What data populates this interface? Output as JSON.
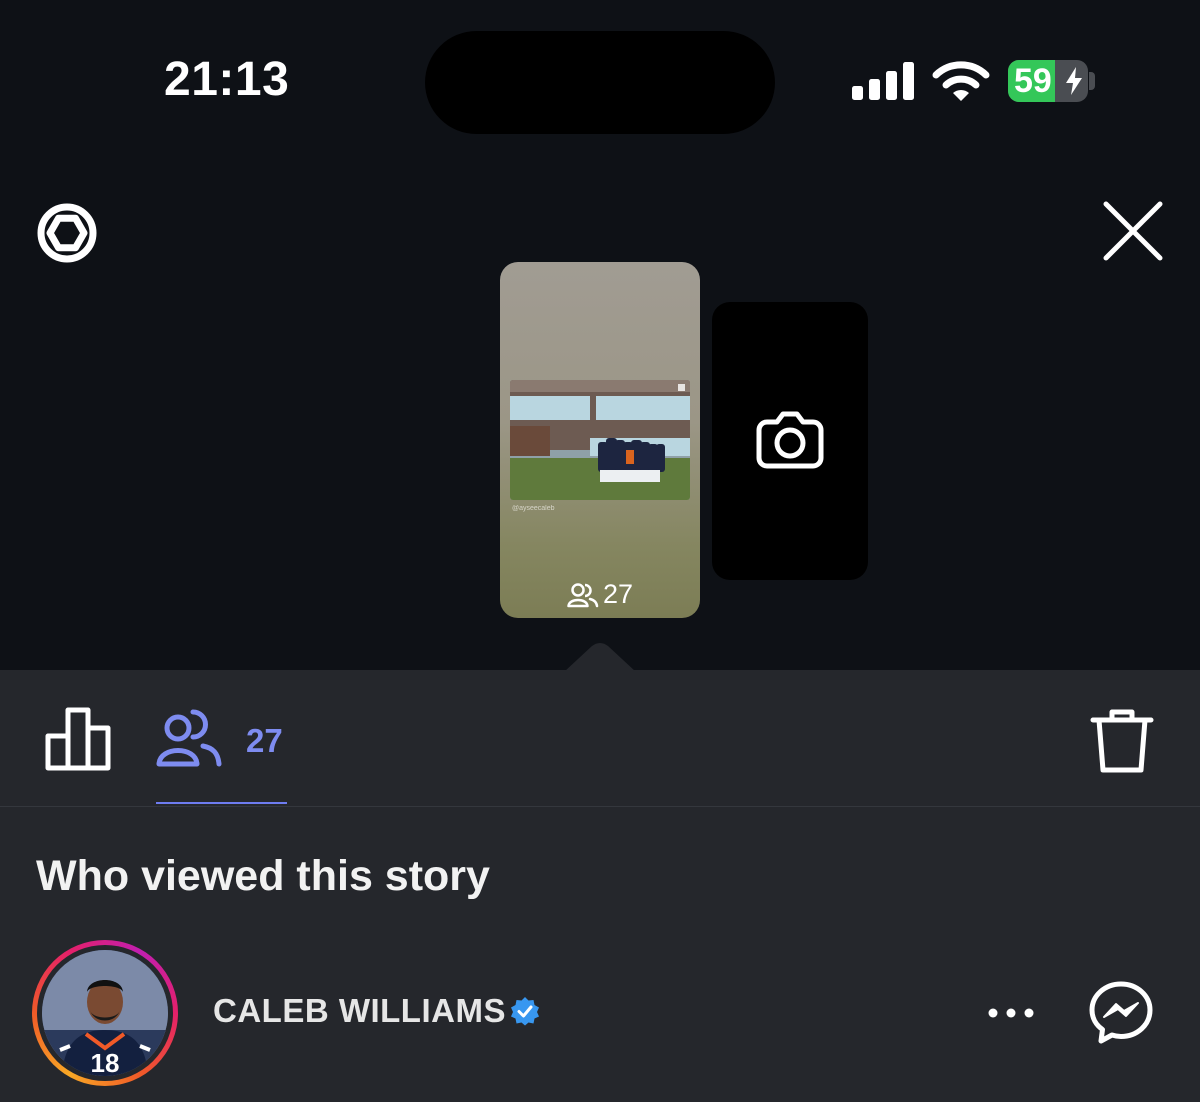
{
  "status_bar": {
    "time": "21:13",
    "battery_percent": "59",
    "battery_level": 0.59,
    "battery_color": "#34c759"
  },
  "top_controls": {
    "left_icon": "gear-icon",
    "right_icon": "close-icon"
  },
  "story_card": {
    "handle": "@ayseecaleb",
    "viewer_count": "27"
  },
  "camera_card": {
    "icon": "camera-icon"
  },
  "tabs": {
    "insights_icon": "bar-chart-icon",
    "viewers_icon": "people-icon",
    "viewers_count": "27",
    "active_color": "#7e8cf0",
    "trash_icon": "trash-icon"
  },
  "section": {
    "title": "Who viewed this story"
  },
  "viewers": [
    {
      "name": "CALEB WILLIAMS",
      "verified": true,
      "verified_color": "#3897f0",
      "jersey_number": "18"
    }
  ]
}
